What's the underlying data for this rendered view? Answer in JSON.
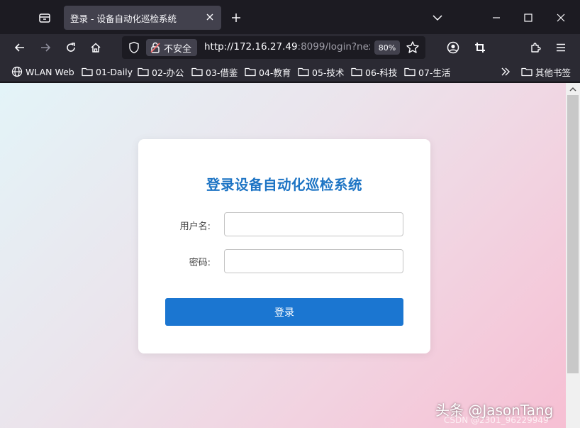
{
  "browser": {
    "tab_title": "登录 - 设备自动化巡检系统",
    "address": {
      "insecure_label": "不安全",
      "url_host": "http://172.16.27.49",
      "url_rest": ":8099/login?nex",
      "zoom": "80%"
    },
    "bookmarks": [
      {
        "label": "WLAN Web",
        "icon": "globe-icon"
      },
      {
        "label": "01-Daily",
        "icon": "folder-icon"
      },
      {
        "label": "02-办公",
        "icon": "folder-icon"
      },
      {
        "label": "03-借鉴",
        "icon": "folder-icon"
      },
      {
        "label": "04-教育",
        "icon": "folder-icon"
      },
      {
        "label": "05-技术",
        "icon": "folder-icon"
      },
      {
        "label": "06-科技",
        "icon": "folder-icon"
      },
      {
        "label": "07-生活",
        "icon": "folder-icon"
      }
    ],
    "other_bookmarks": "其他书签"
  },
  "login": {
    "title": "登录设备自动化巡检系统",
    "username_label": "用户名:",
    "username_value": "",
    "password_label": "密码:",
    "password_value": "",
    "submit_label": "登录"
  },
  "watermark": {
    "text": "头条 @JasonTang",
    "sub": "CSDN @2301_96229949"
  }
}
